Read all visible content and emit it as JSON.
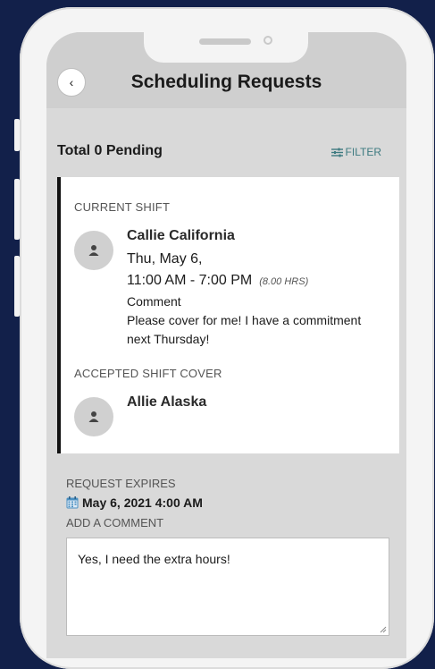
{
  "header": {
    "title": "Scheduling Requests",
    "back_icon": "chevron-left-icon",
    "back_glyph": "‹"
  },
  "summary": {
    "total_pending": "Total 0 Pending",
    "filter_label": "FILTER",
    "filter_icon": "sliders-icon"
  },
  "current_shift": {
    "section_label": "CURRENT SHIFT",
    "name": "Callie California",
    "date": "Thu, May 6,",
    "time": "11:00 AM - 7:00 PM",
    "hours": "(8.00 HRS)",
    "comment_label": "Comment",
    "comment_text": "Please cover for me! I have a commitment next Thursday!"
  },
  "accepted_cover": {
    "section_label": "ACCEPTED SHIFT COVER",
    "name": "Allie Alaska"
  },
  "request": {
    "expires_label": "REQUEST EXPIRES",
    "expires_value": "May 6, 2021 4:00 AM",
    "add_comment_label": "ADD A COMMENT",
    "comment_value": "Yes, I need the extra hours!"
  },
  "colors": {
    "background": "#12204a",
    "accent": "#3d7a80",
    "card_border": "#111111"
  }
}
